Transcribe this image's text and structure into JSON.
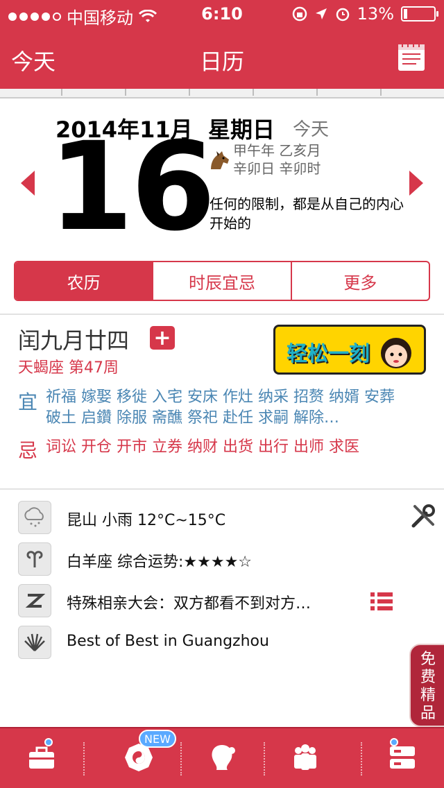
{
  "status_bar": {
    "carrier": "中国移动",
    "time": "6:10",
    "battery": "13%",
    "battery_level": 0.13
  },
  "nav": {
    "left_label": "今天",
    "title": "日历",
    "icon": "calendar-notes-icon"
  },
  "date": {
    "year_month": "2014年11月",
    "weekday": "星期日",
    "today_label": "今天",
    "day": "16",
    "ganzhi_line1": "甲午年 乙亥月",
    "ganzhi_line2": "辛卯日 辛卯时",
    "quote": "任何的限制，都是从自己的内心开始的"
  },
  "segments": [
    "农历",
    "时辰宜忌",
    "更多"
  ],
  "lunar": {
    "date": "闰九月廿四",
    "zodiac_week": "天蝎座 第47周",
    "banner_text": "轻松一刻",
    "yi_label": "宜",
    "yi": "祈福 嫁娶 移徙 入宅 安床 作灶 纳采 招赘 纳婿 安葬 破土 启鑽 除服 斋醮 祭祀 赴任 求嗣 解除…",
    "ji_label": "忌",
    "ji": "词讼 开仓 开市 立券 纳财 出货 出行 出师 求医"
  },
  "info": [
    {
      "icon": "cloud-rain-icon",
      "text": "昆山 小雨 12°C~15°C"
    },
    {
      "icon": "aries-icon",
      "text": "白羊座 综合运势:★★★★☆"
    },
    {
      "icon": "zhihu-z-icon",
      "text": "特殊相亲大会：双方都看不到对方…"
    },
    {
      "icon": "shell-icon",
      "text": "Best of Best in Guangzhou"
    }
  ],
  "free_tab": "免费精品",
  "tabbar": {
    "new_badge": "NEW",
    "tabs": [
      "toolbox-icon",
      "bagua-icon",
      "girl-profile-icon",
      "people-icon",
      "server-icon"
    ]
  },
  "colors": {
    "brand_red": "#d6374a",
    "text_blue": "#4a86b3",
    "banner_yellow": "#ffd400"
  }
}
